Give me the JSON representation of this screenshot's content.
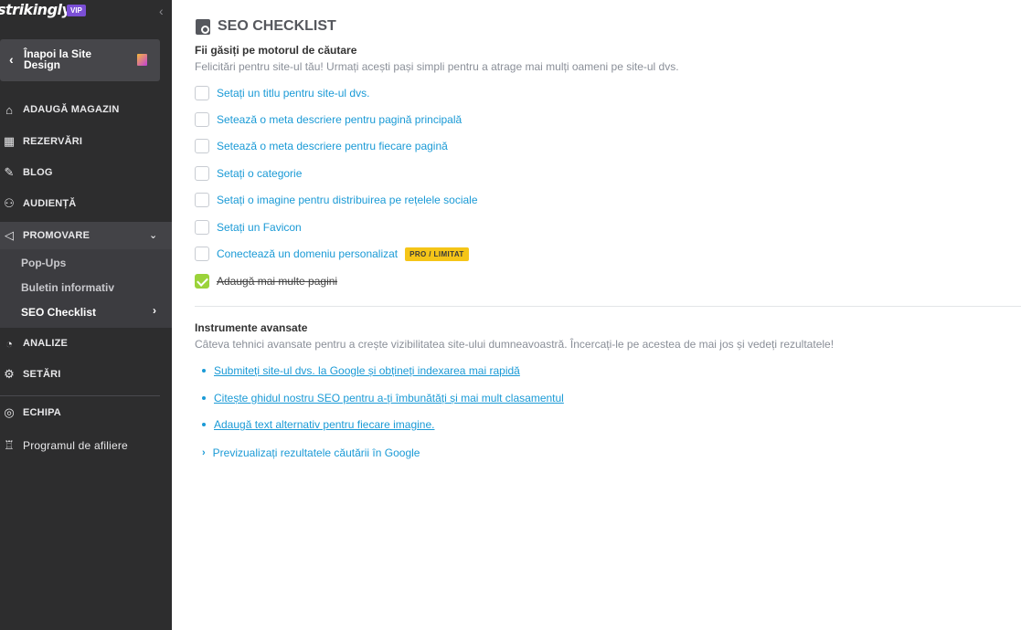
{
  "sidebar": {
    "logo": "strikingly",
    "vip_badge": "VIP",
    "back_button": "Înapoi la Site Design",
    "nav": [
      {
        "label": "ADAUGĂ MAGAZIN",
        "icon": "store-icon"
      },
      {
        "label": "REZERVĂRI",
        "icon": "calendar-icon"
      },
      {
        "label": "BLOG",
        "icon": "feather-icon"
      },
      {
        "label": "AUDIENȚĂ",
        "icon": "users-icon"
      },
      {
        "label": "PROMOVARE",
        "icon": "megaphone-icon"
      },
      {
        "label": "ANALIZE",
        "icon": "pie-chart-icon"
      },
      {
        "label": "SETĂRI",
        "icon": "gear-icon"
      },
      {
        "label": "ECHIPA",
        "icon": "team-icon"
      },
      {
        "label": "Programul de afiliere",
        "icon": "trophy-icon"
      }
    ],
    "submenu": [
      "Pop-Ups",
      "Buletin informativ",
      "SEO Checklist"
    ]
  },
  "main": {
    "title": "SEO CHECKLIST",
    "section1": {
      "title": "Fii găsiți pe motorul de căutare",
      "desc": "Felicitări pentru site-ul tău! Urmați acești pași simpli pentru a atrage mai mulți oameni pe site-ul dvs.",
      "items": [
        "Setați un titlu pentru site-ul dvs.",
        "Setează o meta descriere pentru pagină principală",
        "Setează o meta descriere pentru fiecare pagină",
        "Setați o categorie",
        "Setați o imagine pentru distribuirea pe rețelele sociale",
        "Setați un Favicon",
        "Conectează un domeniu personalizat",
        "Adaugă mai multe pagini"
      ],
      "badge": "PRO / LIMITAT"
    },
    "section2": {
      "title": "Instrumente avansate",
      "desc": "Câteva tehnici avansate pentru a crește vizibilitatea site-ului dumneavoastră. Încercați-le pe acestea de mai jos și vedeți rezultatele!",
      "links": [
        "Submiteți site-ul dvs. la Google și obțineți indexarea mai rapidă",
        "Citește ghidul nostru SEO pentru a-ți îmbunătăți și mai mult clasamentul",
        "Adaugă text alternativ pentru fiecare imagine."
      ],
      "preview": "Previzualizați rezultatele căutării în Google"
    }
  },
  "colors": {
    "sidebar_bg": "#2d2d2e",
    "link": "#1a9ad6",
    "check": "#9bd33a",
    "badge": "#f5c518",
    "vip": "#7b4fd6"
  }
}
